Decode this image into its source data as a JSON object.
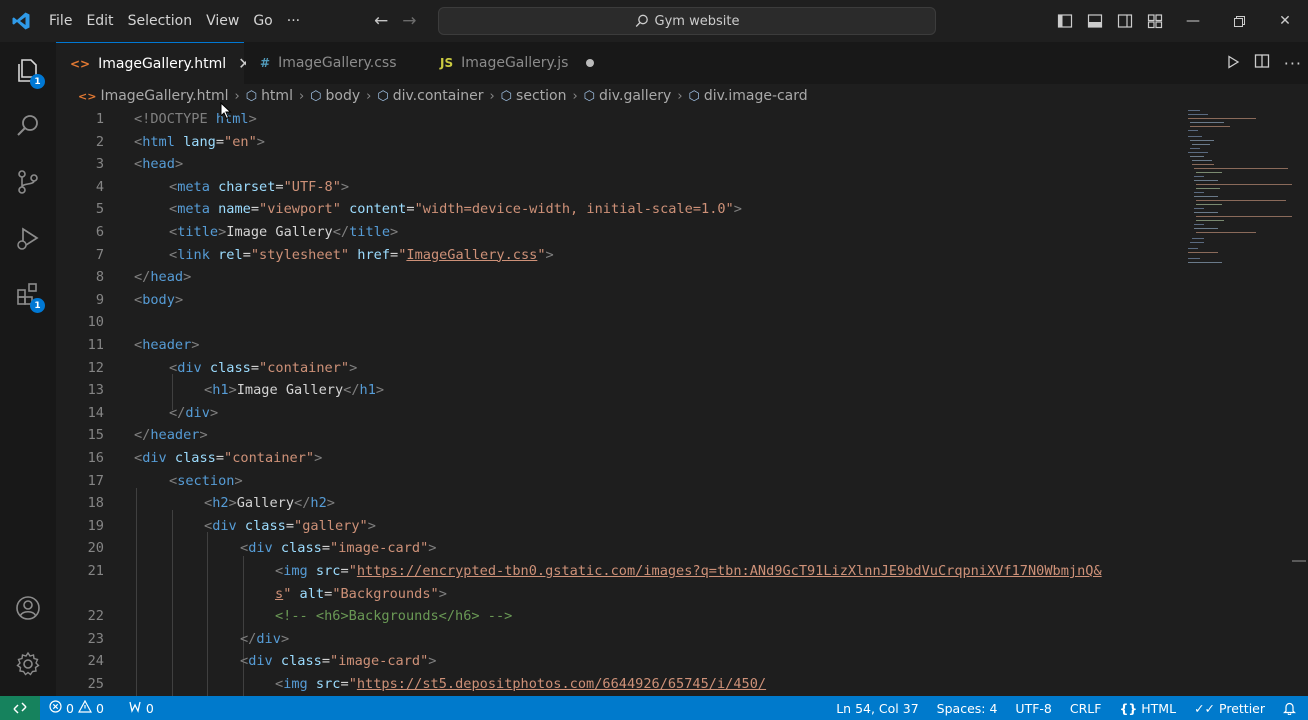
{
  "titlebar": {
    "menu": [
      "File",
      "Edit",
      "Selection",
      "View",
      "Go",
      "···"
    ],
    "search_label": "Gym website"
  },
  "activity": {
    "explorer_badge": "1",
    "extensions_badge": "1"
  },
  "tabs": [
    {
      "label": "ImageGallery.html",
      "icon": "<>",
      "icon_color": "#e37933",
      "state": "active"
    },
    {
      "label": "ImageGallery.css",
      "icon": "#",
      "icon_color": "#519aba",
      "state": "inactive"
    },
    {
      "label": "ImageGallery.js",
      "icon": "JS",
      "icon_color": "#cbcb41",
      "state": "modified"
    }
  ],
  "breadcrumb": [
    "ImageGallery.html",
    "html",
    "body",
    "div.container",
    "section",
    "div.gallery",
    "div.image-card"
  ],
  "code": {
    "line_numbers": [
      "1",
      "2",
      "3",
      "4",
      "5",
      "6",
      "7",
      "8",
      "9",
      "10",
      "11",
      "12",
      "13",
      "14",
      "15",
      "16",
      "17",
      "18",
      "19",
      "20",
      "21",
      "",
      "22",
      "23",
      "24",
      "25"
    ],
    "l1_a": "<!DOCTYPE ",
    "l1_b": "html",
    "l1_c": ">",
    "l2_a": "<",
    "l2_b": "html",
    "l2_c": " lang",
    "l2_d": "=",
    "l2_e": "\"en\"",
    "l2_f": ">",
    "l3_a": "<",
    "l3_b": "head",
    "l3_c": ">",
    "l4_a": "<",
    "l4_b": "meta",
    "l4_c": " charset",
    "l4_d": "=",
    "l4_e": "\"UTF-8\"",
    "l4_f": ">",
    "l5_a": "<",
    "l5_b": "meta",
    "l5_c": " name",
    "l5_d": "=",
    "l5_e": "\"viewport\"",
    "l5_f": " content",
    "l5_g": "=",
    "l5_h": "\"width=device-width, initial-scale=1.0\"",
    "l5_i": ">",
    "l6_a": "<",
    "l6_b": "title",
    "l6_c": ">",
    "l6_d": "Image Gallery",
    "l6_e": "</",
    "l6_f": "title",
    "l6_g": ">",
    "l7_a": "<",
    "l7_b": "link",
    "l7_c": " rel",
    "l7_d": "=",
    "l7_e": "\"stylesheet\"",
    "l7_f": " href",
    "l7_g": "=",
    "l7_h": "\"",
    "l7_i": "ImageGallery.css",
    "l7_j": "\"",
    "l7_k": ">",
    "l8_a": "</",
    "l8_b": "head",
    "l8_c": ">",
    "l9_a": "<",
    "l9_b": "body",
    "l9_c": ">",
    "l11_a": "<",
    "l11_b": "header",
    "l11_c": ">",
    "l12_a": "<",
    "l12_b": "div",
    "l12_c": " class",
    "l12_d": "=",
    "l12_e": "\"container\"",
    "l12_f": ">",
    "l13_a": "<",
    "l13_b": "h1",
    "l13_c": ">",
    "l13_d": "Image Gallery",
    "l13_e": "</",
    "l13_f": "h1",
    "l13_g": ">",
    "l14_a": "</",
    "l14_b": "div",
    "l14_c": ">",
    "l15_a": "</",
    "l15_b": "header",
    "l15_c": ">",
    "l16_a": "<",
    "l16_b": "div",
    "l16_c": " class",
    "l16_d": "=",
    "l16_e": "\"container\"",
    "l16_f": ">",
    "l17_a": "<",
    "l17_b": "section",
    "l17_c": ">",
    "l18_a": "<",
    "l18_b": "h2",
    "l18_c": ">",
    "l18_d": "Gallery",
    "l18_e": "</",
    "l18_f": "h2",
    "l18_g": ">",
    "l19_a": "<",
    "l19_b": "div",
    "l19_c": " class",
    "l19_d": "=",
    "l19_e": "\"gallery\"",
    "l19_f": ">",
    "l20_a": "<",
    "l20_b": "div",
    "l20_c": " class",
    "l20_d": "=",
    "l20_e": "\"image-card\"",
    "l20_f": ">",
    "l21_a": "<",
    "l21_b": "img",
    "l21_c": " src",
    "l21_d": "=",
    "l21_e": "\"",
    "l21_f": "https://encrypted-tbn0.gstatic.com/images?q=tbn:ANd9GcT91LizXlnnJE9bdVuCrqpniXVf17N0WbmjnQ&",
    "l21w_a": "s",
    "l21w_b": "\"",
    "l21w_c": " alt",
    "l21w_d": "=",
    "l21w_e": "\"Backgrounds\"",
    "l21w_f": ">",
    "l22": "<!-- <h6>Backgrounds</h6> -->",
    "l23_a": "</",
    "l23_b": "div",
    "l23_c": ">",
    "l24_a": "<",
    "l24_b": "div",
    "l24_c": " class",
    "l24_d": "=",
    "l24_e": "\"image-card\"",
    "l24_f": ">",
    "l25_a": "<",
    "l25_b": "img",
    "l25_c": " src",
    "l25_d": "=",
    "l25_e": "\"",
    "l25_f": "https://st5.depositphotos.com/6644926/65745/i/450/"
  },
  "statusbar": {
    "errors": "0",
    "warnings": "0",
    "ports": "0",
    "position": "Ln 54, Col 37",
    "spaces": "Spaces: 4",
    "encoding": "UTF-8",
    "eol": "CRLF",
    "language": "HTML",
    "formatter": "Prettier"
  },
  "colors": {
    "accent": "#007acc",
    "tag": "#569cd6",
    "attribute": "#9cdcfe",
    "string": "#ce9178",
    "comment": "#6a9955"
  }
}
